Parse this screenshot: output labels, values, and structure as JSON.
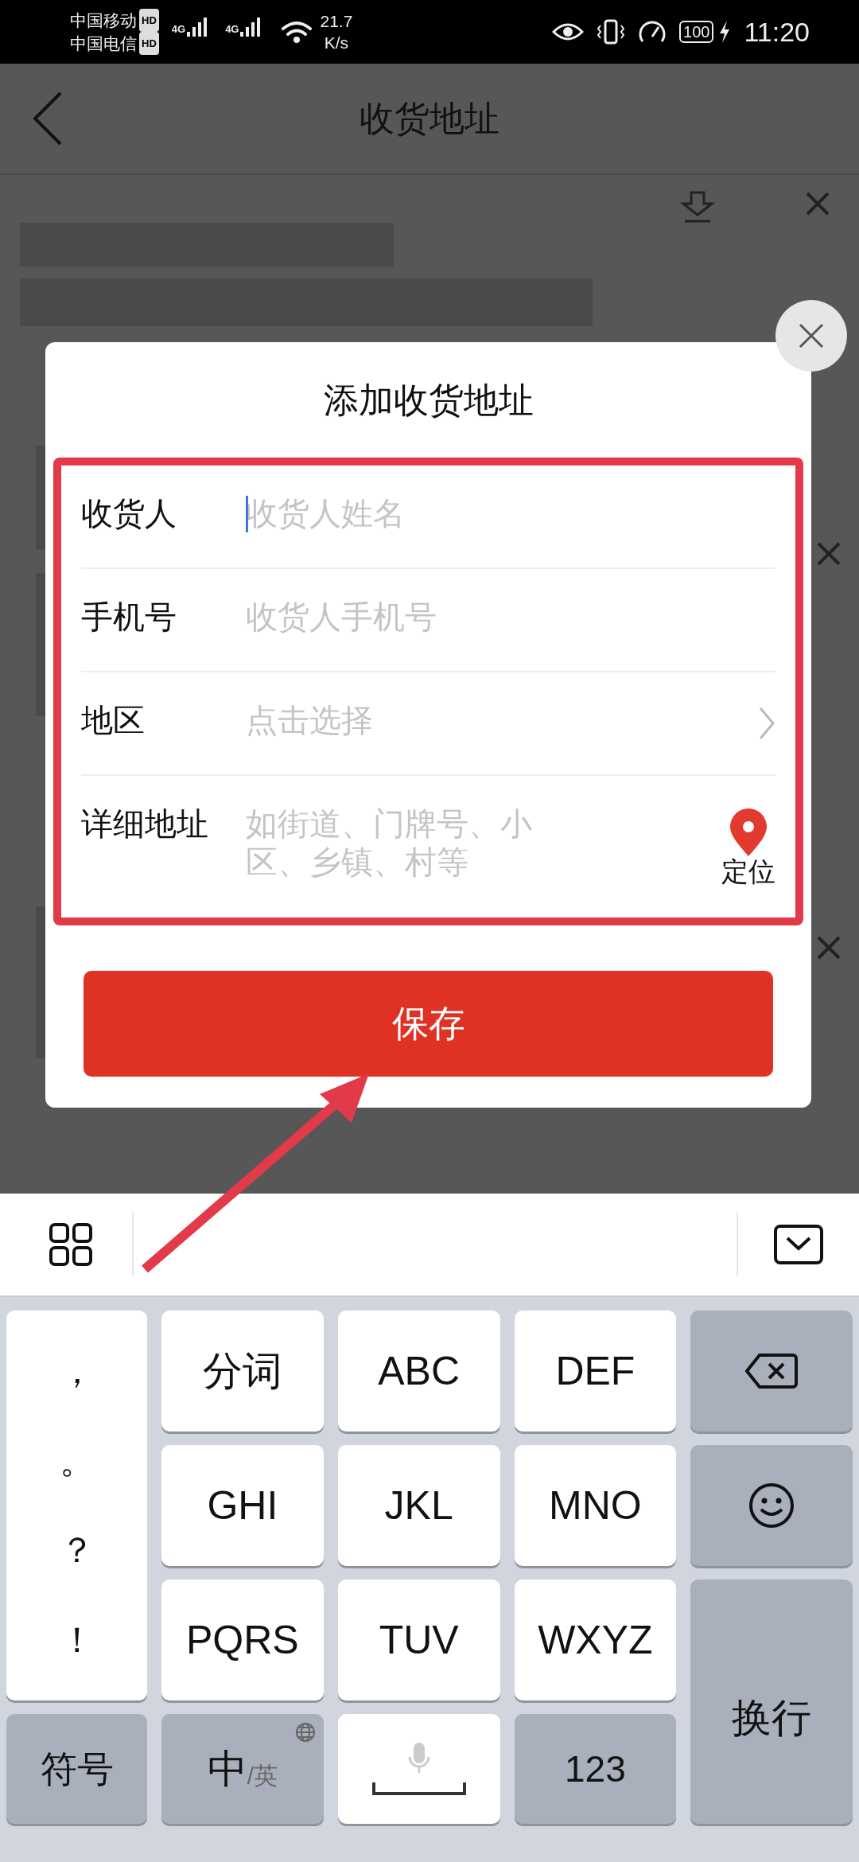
{
  "status_bar": {
    "carriers": [
      {
        "name": "中国移动",
        "badge": "HD",
        "network": "4G"
      },
      {
        "name": "中国电信",
        "badge": "HD",
        "network": "4G"
      }
    ],
    "speed_value": "21.7",
    "speed_unit": "K/s",
    "battery": "100",
    "time": "11:20"
  },
  "header": {
    "title": "收货地址"
  },
  "dialog": {
    "title": "添加收货地址",
    "fields": [
      {
        "kind": "input",
        "label": "收货人",
        "placeholder": "收货人姓名",
        "focused": true
      },
      {
        "kind": "input",
        "label": "手机号",
        "placeholder": "收货人手机号",
        "focused": false
      },
      {
        "kind": "select",
        "label": "地区",
        "placeholder": "点击选择",
        "focused": false
      },
      {
        "kind": "textarea",
        "label": "详细地址",
        "placeholder": "如街道、门牌号、小区、乡镇、村等",
        "focused": false,
        "action": "定位"
      }
    ],
    "save_button": "保存"
  },
  "keyboard": {
    "punctuation": [
      "，",
      "。",
      "？",
      "！"
    ],
    "keys": [
      {
        "kind": "text",
        "label": "分词"
      },
      {
        "kind": "text",
        "label": "ABC"
      },
      {
        "kind": "text",
        "label": "DEF"
      },
      {
        "kind": "backspace"
      },
      {
        "kind": "text",
        "label": "GHI"
      },
      {
        "kind": "text",
        "label": "JKL"
      },
      {
        "kind": "text",
        "label": "MNO"
      },
      {
        "kind": "emoji"
      },
      {
        "kind": "text",
        "label": "PQRS"
      },
      {
        "kind": "text",
        "label": "TUV"
      },
      {
        "kind": "text",
        "label": "WXYZ"
      },
      {
        "kind": "enter",
        "label": "换行"
      },
      {
        "kind": "symbol",
        "label": "符号"
      },
      {
        "kind": "lang",
        "label": "中",
        "sub": "/英"
      },
      {
        "kind": "space"
      },
      {
        "kind": "symbol",
        "label": "123"
      }
    ]
  }
}
